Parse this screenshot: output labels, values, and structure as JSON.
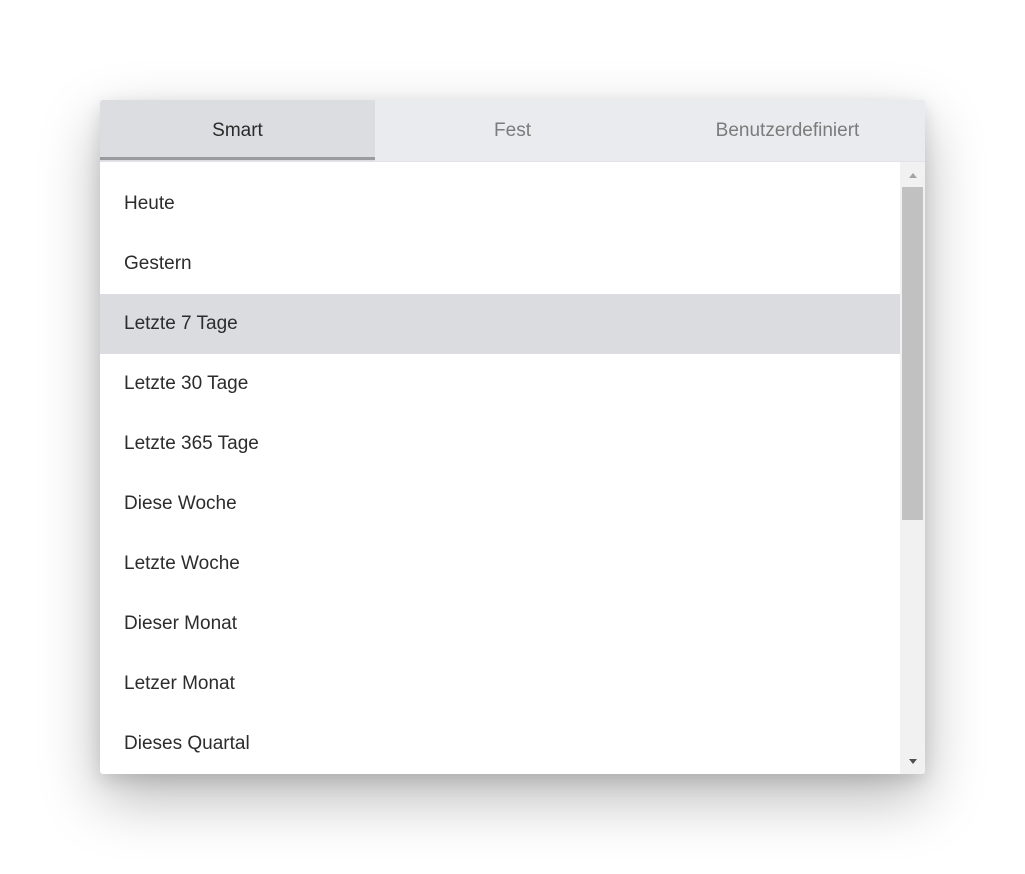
{
  "tabs": [
    {
      "label": "Smart",
      "active": true
    },
    {
      "label": "Fest",
      "active": false
    },
    {
      "label": "Benutzerdefiniert",
      "active": false
    }
  ],
  "items": [
    {
      "label": "Heute"
    },
    {
      "label": "Gestern"
    },
    {
      "label": "Letzte 7 Tage",
      "selected": true
    },
    {
      "label": "Letzte 30 Tage"
    },
    {
      "label": "Letzte 365 Tage"
    },
    {
      "label": "Diese Woche"
    },
    {
      "label": "Letzte Woche"
    },
    {
      "label": "Dieser Monat"
    },
    {
      "label": "Letzer Monat"
    },
    {
      "label": "Dieses Quartal"
    }
  ],
  "scrollbar": {
    "up_icon": "triangle-up-icon",
    "down_icon": "triangle-down-icon",
    "position": 0
  },
  "colors": {
    "tab_bar_bg": "#eaebee",
    "active_tab_bg": "#dcdde1",
    "selected_item_bg": "#dbdce0",
    "active_indicator": "#9a9b9f"
  }
}
